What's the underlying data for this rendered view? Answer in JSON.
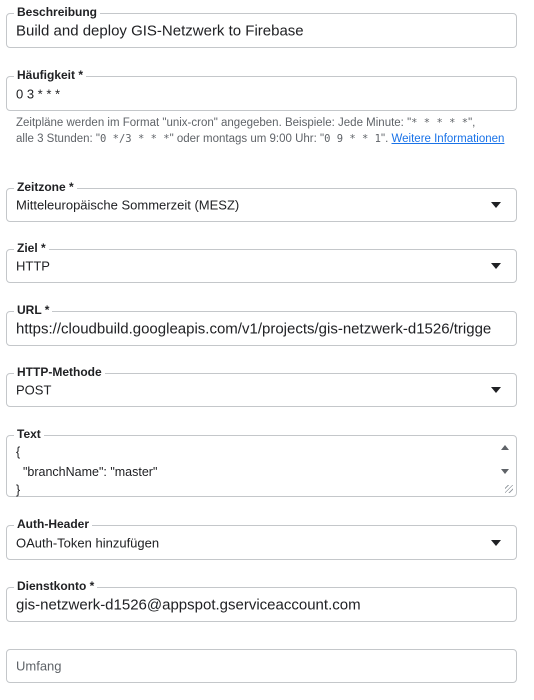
{
  "description": {
    "label": "Beschreibung",
    "value": "Build and deploy GIS-Netzwerk to Firebase"
  },
  "frequency": {
    "label": "Häufigkeit *",
    "value": "0 3 * * *",
    "help_part1": "Zeitpläne werden im Format \"unix-cron\" angegeben. Beispiele: Jede Minute: \"",
    "help_code1": "* * * * *",
    "help_part2": "\",",
    "help_part3": "alle 3 Stunden: \"",
    "help_code2": "0 */3 * * *",
    "help_part4": "\" oder montags um 9:00 Uhr: \"",
    "help_code3": "0 9 * * 1",
    "help_part5": "\".",
    "help_link": "Weitere Informationen"
  },
  "timezone": {
    "label": "Zeitzone *",
    "value": "Mitteleuropäische Sommerzeit (MESZ)"
  },
  "target": {
    "label": "Ziel *",
    "value": "HTTP"
  },
  "url": {
    "label": "URL *",
    "value": "https://cloudbuild.googleapis.com/v1/projects/gis-netzwerk-d1526/trigge"
  },
  "http_method": {
    "label": "HTTP-Methode",
    "value": "POST"
  },
  "body": {
    "label": "Text",
    "lines": [
      "{",
      "  \"branchName\": \"master\"",
      "}"
    ]
  },
  "auth_header": {
    "label": "Auth-Header",
    "value": "OAuth-Token hinzufügen"
  },
  "service_account": {
    "label": "Dienstkonto *",
    "value": "gis-netzwerk-d1526@appspot.gserviceaccount.com"
  },
  "scope": {
    "placeholder": "Umfang"
  }
}
